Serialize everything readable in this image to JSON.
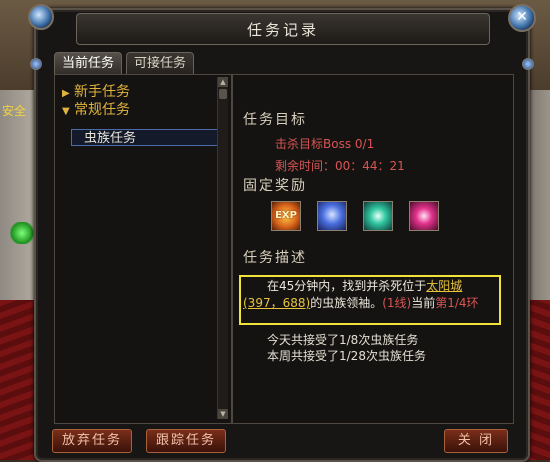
{
  "background": {
    "safe_label": "安全"
  },
  "window": {
    "title": "任务记录",
    "close_glyph": "✕",
    "tabs": [
      {
        "label": "当前任务",
        "active": true
      },
      {
        "label": "可接任务",
        "active": false
      }
    ]
  },
  "quest_tree": {
    "categories": [
      {
        "label": "新手任务",
        "expanded": false
      },
      {
        "label": "常规任务",
        "expanded": true
      }
    ],
    "selected_item": "虫族任务"
  },
  "details": {
    "objective_header": "任务目标",
    "objective_text": "击杀目标Boss 0/1",
    "time_text": "剩余时间：00：44：21",
    "reward_header": "固定奖励",
    "rewards": [
      {
        "icon": "exp-icon",
        "label": "EXP"
      },
      {
        "icon": "blue-scroll-icon"
      },
      {
        "icon": "teal-crystal-icon"
      },
      {
        "icon": "pink-magic-icon"
      }
    ],
    "description_header": "任务描述",
    "description": {
      "part1": "在45分钟内，找到并杀死位于",
      "city": "太阳城",
      "coords": "(397，688)",
      "part2": "的虫族领袖。",
      "line_tag": "(1线)",
      "part3": "当前",
      "ring": "第1/4环"
    },
    "daily_count": "今天共接受了1/8次虫族任务",
    "weekly_count": "本周共接受了1/28次虫族任务"
  },
  "buttons": {
    "abandon": "放弃任务",
    "track": "跟踪任务",
    "close": "关 闭"
  },
  "colors": {
    "accent_yellow": "#f0e43a",
    "quest_red": "#d65454",
    "category_gold": "#e0b33e"
  }
}
